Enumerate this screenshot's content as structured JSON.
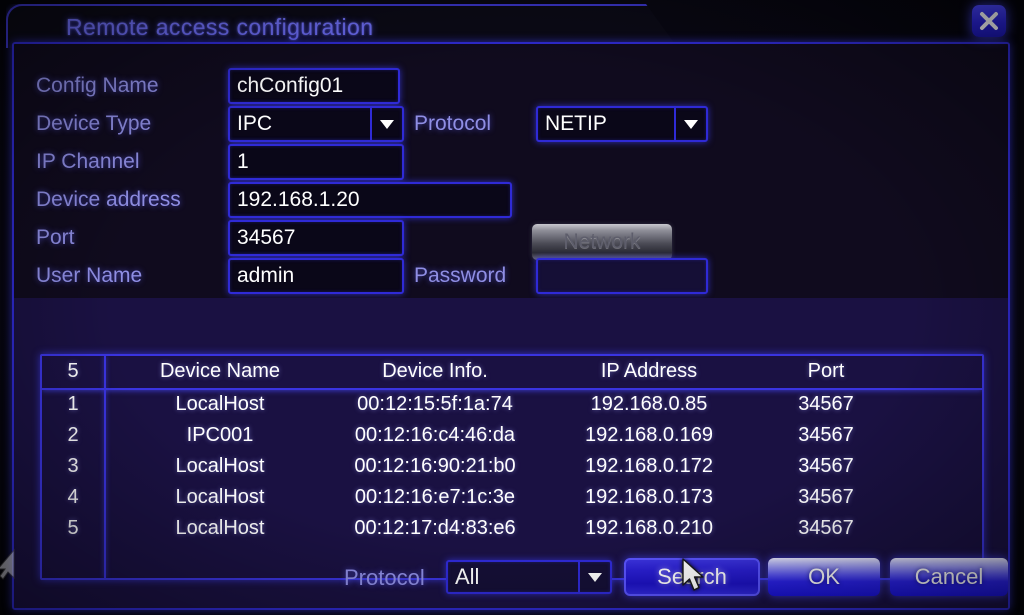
{
  "window": {
    "title": "Remote access configuration",
    "close_icon": "close-icon",
    "close_label": "✖"
  },
  "form": {
    "rows": [
      {
        "label": "Config Name",
        "value": "chConfig01"
      },
      {
        "label": "Device Type",
        "value": "IPC"
      },
      {
        "label": "IP Channel",
        "value": "1"
      },
      {
        "label": "Device address",
        "value": "192.168.1.20"
      },
      {
        "label": "Port",
        "value": "34567"
      },
      {
        "label": "User Name",
        "value": "admin"
      }
    ],
    "protocol_label": "Protocol",
    "protocol_value": "NETIP",
    "password_label": "Password",
    "password_value": "",
    "network_button": "Network"
  },
  "table": {
    "count": "5",
    "headers": [
      "Device Name",
      "Device Info.",
      "IP Address",
      "Port"
    ],
    "rows": [
      {
        "index": "1",
        "name": "LocalHost",
        "info": "00:12:15:5f:1a:74",
        "ip": "192.168.0.85",
        "port": "34567"
      },
      {
        "index": "2",
        "name": "IPC001",
        "info": "00:12:16:c4:46:da",
        "ip": "192.168.0.169",
        "port": "34567"
      },
      {
        "index": "3",
        "name": "LocalHost",
        "info": "00:12:16:90:21:b0",
        "ip": "192.168.0.172",
        "port": "34567"
      },
      {
        "index": "4",
        "name": "LocalHost",
        "info": "00:12:16:e7:1c:3e",
        "ip": "192.168.0.173",
        "port": "34567"
      },
      {
        "index": "5",
        "name": "LocalHost",
        "info": "00:12:17:d4:83:e6",
        "ip": "192.168.0.210",
        "port": "34567"
      }
    ]
  },
  "footer": {
    "protocol_label": "Protocol",
    "protocol_value": "All",
    "search_label": "Search",
    "ok_label": "OK",
    "cancel_label": "Cancel"
  },
  "colors": {
    "accent_border": "#2f2ad6",
    "label_text": "#8f8ee4",
    "value_text": "#ffffff",
    "title_text": "#6b6bf0",
    "panel_top_bg": "#100b1e",
    "panel_bottom_bg": "#1a1142",
    "button_blue": "#2a22e8"
  }
}
